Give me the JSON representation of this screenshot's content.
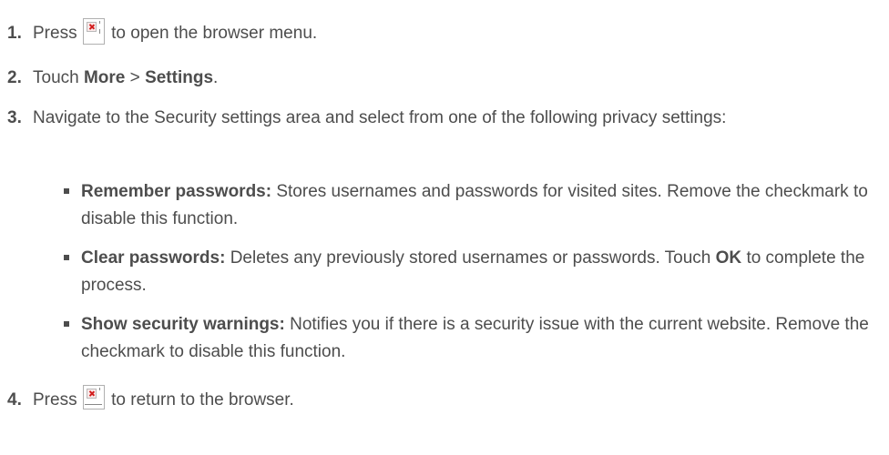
{
  "steps": {
    "s1": {
      "num": "1.",
      "before": "Press",
      "after": "to open the browser menu.",
      "icon": "menu-key-icon"
    },
    "s2": {
      "num": "2.",
      "text1": "Touch",
      "bold1": "More",
      "sep": ">",
      "bold2": "Settings",
      "end": "."
    },
    "s3": {
      "num": "3.",
      "text": "Navigate to the Security settings area and select from one of the following privacy settings:"
    },
    "s4": {
      "num": "4.",
      "before": "Press",
      "after": "to return to the browser.",
      "icon": "back-key-icon"
    }
  },
  "bullets": [
    {
      "label": "Remember passwords:",
      "text": "Stores usernames and passwords for visited sites. Remove the checkmark to disable this function."
    },
    {
      "label": "Clear passwords:",
      "text": "Deletes any previously stored usernames or passwords. Touch",
      "bold": "OK",
      "tail": "to complete the process."
    },
    {
      "label": "Show security warnings:",
      "text": "Notifies you if there is a security issue with the current website. Remove the checkmark to disable this function."
    }
  ]
}
